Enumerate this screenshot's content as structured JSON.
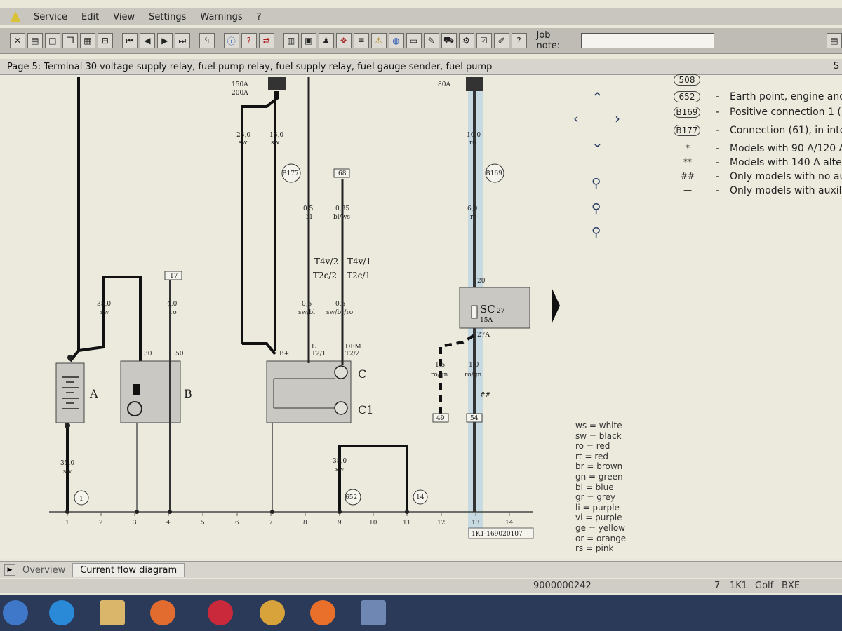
{
  "menu": [
    "Service",
    "Edit",
    "View",
    "Settings",
    "Warnings",
    "?"
  ],
  "toolbar": {
    "job_note_label": "Job note:",
    "job_note_value": ""
  },
  "page_title": "Page 5: Terminal 30 voltage supply relay, fuel pump relay, fuel supply relay, fuel gauge sender, fuel pump",
  "page_title_right": "S",
  "right_legend": [
    {
      "symbol": "508",
      "dash": "",
      "text": ""
    },
    {
      "symbol": "652",
      "dash": "-",
      "text": "Earth point, engine and"
    },
    {
      "symbol": "B169",
      "dash": "-",
      "text": "Positive connection 1 (3"
    },
    {
      "symbol": "B177",
      "dash": "-",
      "text": "Connection (61), in inte"
    },
    {
      "symbol": "*",
      "dash": "-",
      "text": "Models with 90 A/120 A"
    },
    {
      "symbol": "**",
      "dash": "-",
      "text": "Models with 140 A alter"
    },
    {
      "symbol": "##",
      "dash": "-",
      "text": "Only models with no au"
    },
    {
      "symbol": "—",
      "dash": "-",
      "text": "Only models with auxili"
    }
  ],
  "color_legend": [
    "ws = white",
    "sw = black",
    "ro = red",
    "rt = red",
    "br = brown",
    "gn = green",
    "bl = blue",
    "gr = grey",
    "li = purple",
    "vi = purple",
    "ge = yellow",
    "or = orange",
    "rs = pink"
  ],
  "diagram": {
    "fuse_top_left_1": "150A",
    "fuse_top_left_2": "200A",
    "fuse_top_right": "80A",
    "wire_25": "25,0",
    "wire_25_c": "sw",
    "wire_16": "16,0",
    "wire_16_c": "sw",
    "wire_10": "10,0",
    "wire_10_c": "ro",
    "conn_b177": "B177",
    "conn_68": "68",
    "conn_b169": "B169",
    "wire_05bl": "0,5",
    "wire_05bl_c": "bl",
    "wire_035": "0,35",
    "wire_035_c": "bl/ws",
    "wire_60": "6,0",
    "wire_60_c": "ro",
    "t4v2": "T4v/2",
    "t4v1": "T4v/1",
    "t2c2": "T2c/2",
    "t2c1": "T2c/1",
    "label_20": "20",
    "sc_label": "SC",
    "sc_num": "27",
    "sc_amp": "15A",
    "label_27a": "27A",
    "conn_17": "17",
    "wire_350_a": "35,0",
    "wire_350_a_c": "sw",
    "wire_40": "4,0",
    "wire_40_c": "ro",
    "wire_05swbl": "0,5",
    "wire_05swbl_c": "sw/bl",
    "wire_05swbr": "0,5",
    "wire_05swbr_c": "sw/br/ro",
    "label_l": "L",
    "label_t21": "T2/1",
    "label_dfm": "DFM",
    "label_t22": "T2/2",
    "label_bplus": "B+",
    "label_30": "30",
    "label_50": "50",
    "comp_a": "A",
    "comp_b": "B",
    "comp_c": "C",
    "comp_c1": "C1",
    "wire_15": "1,5",
    "wire_15_c": "ro/gn",
    "wire_10b": "1,0",
    "wire_10b_c": "ro/gn",
    "hashes": "##",
    "conn_49": "49",
    "conn_54": "54",
    "wire_350_b": "35,0",
    "wire_350_b_c": "sw",
    "wire_350_c": "35,0",
    "wire_350_c_c": "sw",
    "earth_1": "1",
    "earth_652": "652",
    "earth_14": "14",
    "ruler": [
      "1",
      "2",
      "3",
      "4",
      "5",
      "6",
      "7",
      "8",
      "9",
      "10",
      "11",
      "12",
      "13",
      "14"
    ],
    "diagram_id": "1K1-169020107"
  },
  "tabs": [
    "Overview",
    "Current flow diagram"
  ],
  "status": {
    "number": "9000000242",
    "f1": "7",
    "f2": "1K1",
    "f3": "Golf",
    "f4": "BXE"
  }
}
